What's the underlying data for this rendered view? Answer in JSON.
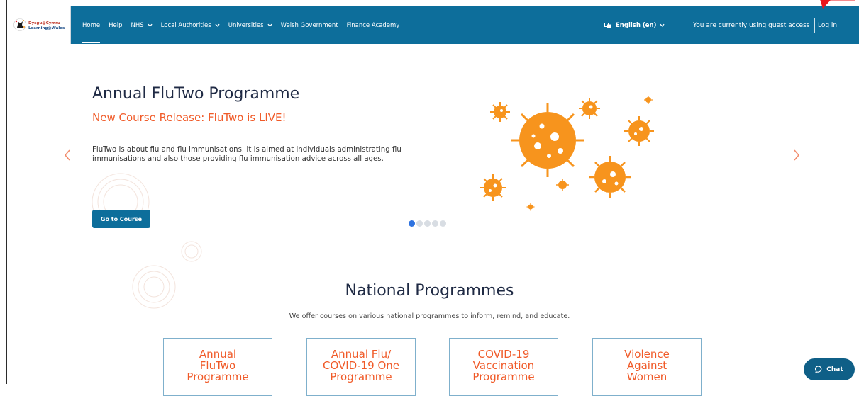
{
  "header": {
    "logo": {
      "line1": "Dysgu@Cymru",
      "line2": "Learning@Wales"
    },
    "nav": [
      {
        "label": "Home",
        "active": true,
        "dropdown": false
      },
      {
        "label": "Help",
        "active": false,
        "dropdown": false
      },
      {
        "label": "NHS",
        "active": false,
        "dropdown": true
      },
      {
        "label": "Local Authorities",
        "active": false,
        "dropdown": true
      },
      {
        "label": "Universities",
        "active": false,
        "dropdown": true
      },
      {
        "label": "Welsh Government",
        "active": false,
        "dropdown": false
      },
      {
        "label": "Finance Academy",
        "active": false,
        "dropdown": false
      }
    ],
    "language": "English (en)",
    "guest_text": "You are currently using guest access",
    "login_label": "Log in"
  },
  "hero": {
    "title": "Annual FluTwo Programme",
    "subtitle": "New Course Release: FluTwo is LIVE!",
    "description": "FluTwo is about flu and flu immunisations. It is aimed at individuals administrating flu immunisations and also those providing flu immunisation advice across all ages.",
    "button_label": "Go to Course",
    "slide_count": 5,
    "active_slide": 1
  },
  "programmes": {
    "title": "National Programmes",
    "subtitle": "We offer courses on various national programmes to inform, remind, and educate.",
    "cards": [
      {
        "lines": [
          "Annual",
          "FluTwo",
          "Programme"
        ]
      },
      {
        "lines": [
          "Annual Flu/",
          "COVID-19 One",
          "Programme"
        ]
      },
      {
        "lines": [
          "COVID-19",
          "Vaccination",
          "Programme"
        ]
      },
      {
        "lines": [
          "Violence",
          "Against",
          "Women"
        ]
      }
    ]
  },
  "chat": {
    "label": "Chat"
  },
  "colors": {
    "navbar": "#0d6e9b",
    "accent_orange": "#f05a28",
    "virus_orange": "#f7941d",
    "heading": "#1f2a44",
    "active_dot": "#2f73e0",
    "annotation_red": "#e8141b"
  }
}
